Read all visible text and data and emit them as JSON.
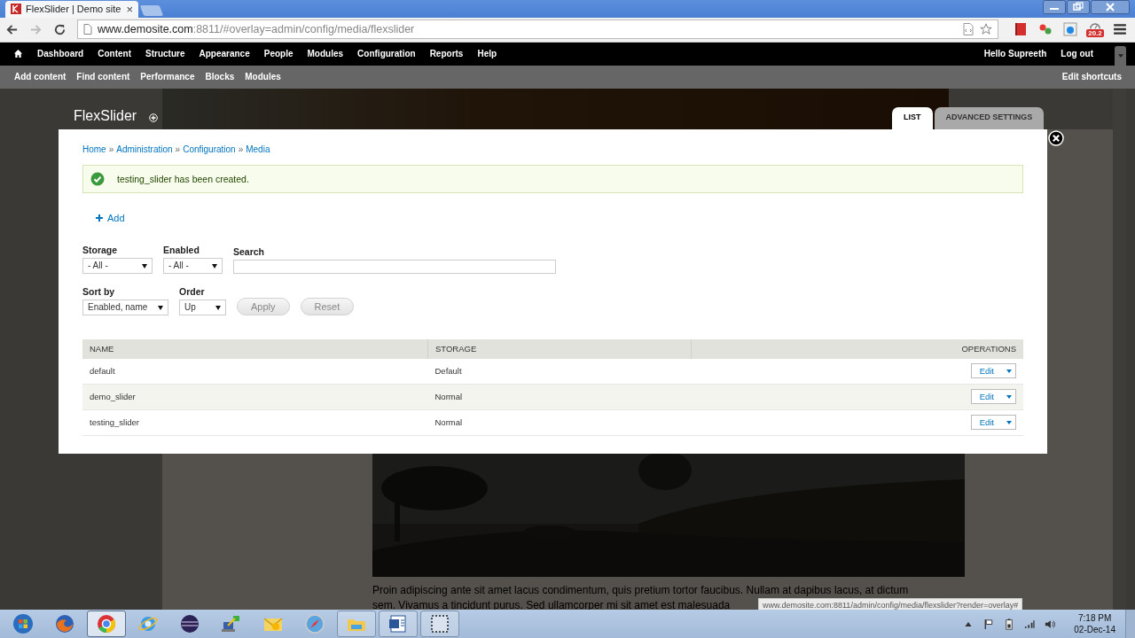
{
  "browser": {
    "tab_title": "FlexSlider | Demo site",
    "tab_close": "×",
    "url_host": "www.demosite.com",
    "url_rest": ":8811/#overlay=admin/config/media/flexslider",
    "badge": "20.2"
  },
  "admin_menu": {
    "items": [
      "Dashboard",
      "Content",
      "Structure",
      "Appearance",
      "People",
      "Modules",
      "Configuration",
      "Reports",
      "Help"
    ],
    "greeting": "Hello",
    "user": "Supreeth",
    "logout": "Log out"
  },
  "shortcuts": {
    "items": [
      "Add content",
      "Find content",
      "Performance",
      "Blocks",
      "Modules"
    ],
    "edit": "Edit shortcuts"
  },
  "site": {
    "body_lines": [
      "Proin adipiscing ante sit amet lacus condimentum, quis pretium tortor faucibus. Nullam at dapibus lacus, at dictum",
      "sem. Vivamus a tincidunt purus. Sed ullamcorper mi sit amet est malesuada"
    ]
  },
  "overlay": {
    "title": "FlexSlider",
    "tabs": [
      {
        "label": "LIST",
        "selected": true
      },
      {
        "label": "ADVANCED SETTINGS",
        "selected": false
      }
    ],
    "breadcrumb": {
      "separator": "»",
      "items": [
        "Home",
        "Administration",
        "Configuration",
        "Media"
      ]
    },
    "message": {
      "kind": "status",
      "text": "testing_slider has been created."
    },
    "add_link": "Add",
    "filters": [
      {
        "label": "Storage",
        "kind": "select",
        "value": "- All -"
      },
      {
        "label": "Enabled",
        "kind": "select",
        "value": "- All -"
      },
      {
        "label": "Search",
        "kind": "text"
      }
    ],
    "sort": [
      {
        "label": "Sort by",
        "kind": "select",
        "value": "Enabled, name"
      },
      {
        "label": "Order",
        "kind": "select",
        "value": "Up"
      }
    ],
    "buttons": [
      "Apply",
      "Reset"
    ],
    "table": {
      "columns": [
        "NAME",
        "STORAGE",
        "OPERATIONS"
      ],
      "rows": [
        {
          "name": "default",
          "storage": "Default",
          "operation": "Edit"
        },
        {
          "name": "demo_slider",
          "storage": "Normal",
          "operation": "Edit"
        },
        {
          "name": "testing_slider",
          "storage": "Normal",
          "operation": "Edit"
        }
      ]
    }
  },
  "status_url": "www.demosite.com:8811/admin/config/media/flexslider?render=overlay#",
  "taskbar": {
    "apps": [
      {
        "kind": "start",
        "running": false,
        "selected": false
      },
      {
        "kind": "firefox",
        "running": false,
        "selected": false
      },
      {
        "kind": "chrome",
        "running": true,
        "selected": true
      },
      {
        "kind": "ie",
        "running": false,
        "selected": false
      },
      {
        "kind": "eclipse",
        "running": false,
        "selected": false
      },
      {
        "kind": "network",
        "running": false,
        "selected": false
      },
      {
        "kind": "mail",
        "running": false,
        "selected": false
      },
      {
        "kind": "compass",
        "running": false,
        "selected": false
      },
      {
        "kind": "folder",
        "running": true,
        "selected": false
      },
      {
        "kind": "word",
        "running": true,
        "selected": false
      },
      {
        "kind": "snip",
        "running": true,
        "selected": false
      }
    ],
    "time": "7:18 PM",
    "date": "02-Dec-14"
  }
}
